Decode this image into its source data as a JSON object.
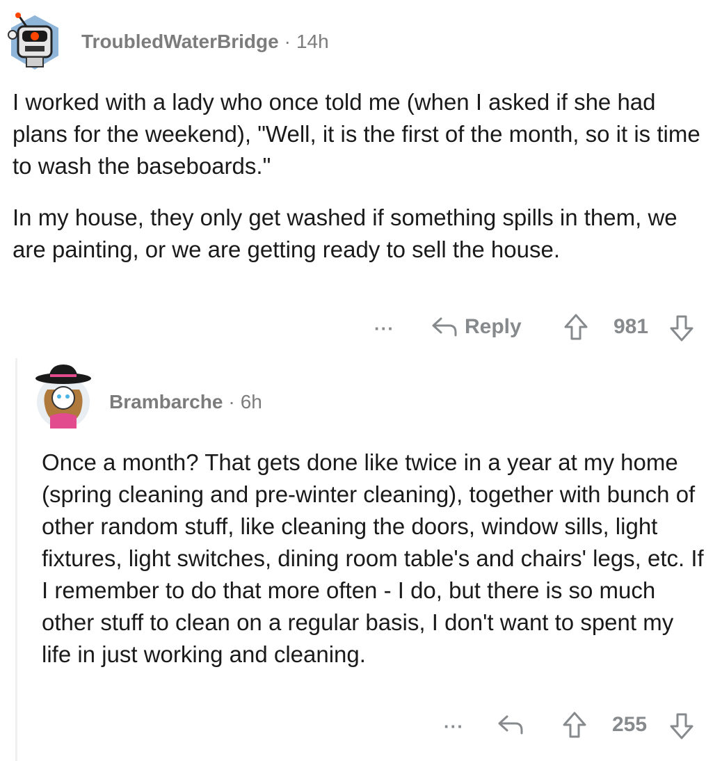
{
  "comment1": {
    "username": "TroubledWaterBridge",
    "separator": "·",
    "age": "14h",
    "paragraphs": [
      "I worked with a lady who once told me (when I asked if she had plans for the weekend), \"Well, it is the first of the month, so it is time to wash the baseboards.\"",
      "In my house, they only get washed if something spills in them, we are painting, or we are getting ready to sell the house."
    ],
    "more_label": "···",
    "reply_label": "Reply",
    "score": "981",
    "icons": {
      "more": "more-icon",
      "reply": "reply-arrow-icon",
      "upvote": "upvote-arrow-icon",
      "downvote": "downvote-arrow-icon",
      "avatar": "robot-avatar-icon"
    }
  },
  "comment2": {
    "username": "Brambarche",
    "separator": "·",
    "age": "6h",
    "paragraphs": [
      "Once a month? That gets done like twice in a year at my home (spring cleaning and pre-winter cleaning), together with bunch of other random stuff, like cleaning the doors, window sills, light fixtures, light switches, dining room table's and chairs' legs, etc. If I remember to do that more often - I do, but there is so much other stuff to clean on a regular basis, I don't want to spent my life in just working and cleaning."
    ],
    "more_label": "···",
    "score": "255",
    "icons": {
      "more": "more-icon",
      "reply": "reply-arrow-icon",
      "upvote": "upvote-arrow-icon",
      "downvote": "downvote-arrow-icon",
      "avatar": "cowboy-hat-avatar-icon"
    }
  },
  "colors": {
    "text": "#1a1a1b",
    "meta": "#7c7c7c",
    "icon": "#878a8c",
    "thread_line": "#edeff1"
  }
}
